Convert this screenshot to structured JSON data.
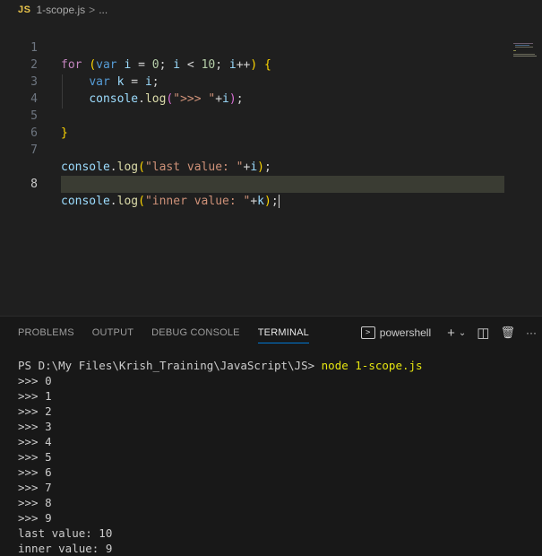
{
  "breadcrumb": {
    "lang_badge": "JS",
    "file": "1-scope.js",
    "separator": ">",
    "ellipsis": "..."
  },
  "editor": {
    "line_numbers": [
      "1",
      "2",
      "3",
      "4",
      "5",
      "6",
      "7",
      "8"
    ],
    "active_line": "8"
  },
  "panel": {
    "tabs": [
      "PROBLEMS",
      "OUTPUT",
      "DEBUG CONSOLE",
      "TERMINAL"
    ],
    "active_tab": "TERMINAL",
    "shell": "powershell",
    "add_icon": "+",
    "chevron_icon": "⌄",
    "split_icon": "◫",
    "trash_icon": "🗑",
    "more_icon": "···"
  },
  "terminal": {
    "prompt": "PS D:\\My Files\\Krish_Training\\JavaScript\\JS> ",
    "command": "node 1-scope.js",
    "output": [
      ">>> 0",
      ">>> 1",
      ">>> 2",
      ">>> 3",
      ">>> 4",
      ">>> 5",
      ">>> 6",
      ">>> 7",
      ">>> 8",
      ">>> 9",
      "last value: 10",
      "inner value: 9"
    ]
  },
  "colors": {
    "keyword": "#c586c0",
    "storage": "#569cd6",
    "identifier": "#9cdcfe",
    "number": "#b5cea8",
    "string": "#ce9178",
    "function": "#dcdcaa",
    "accent": "#0078d4"
  }
}
